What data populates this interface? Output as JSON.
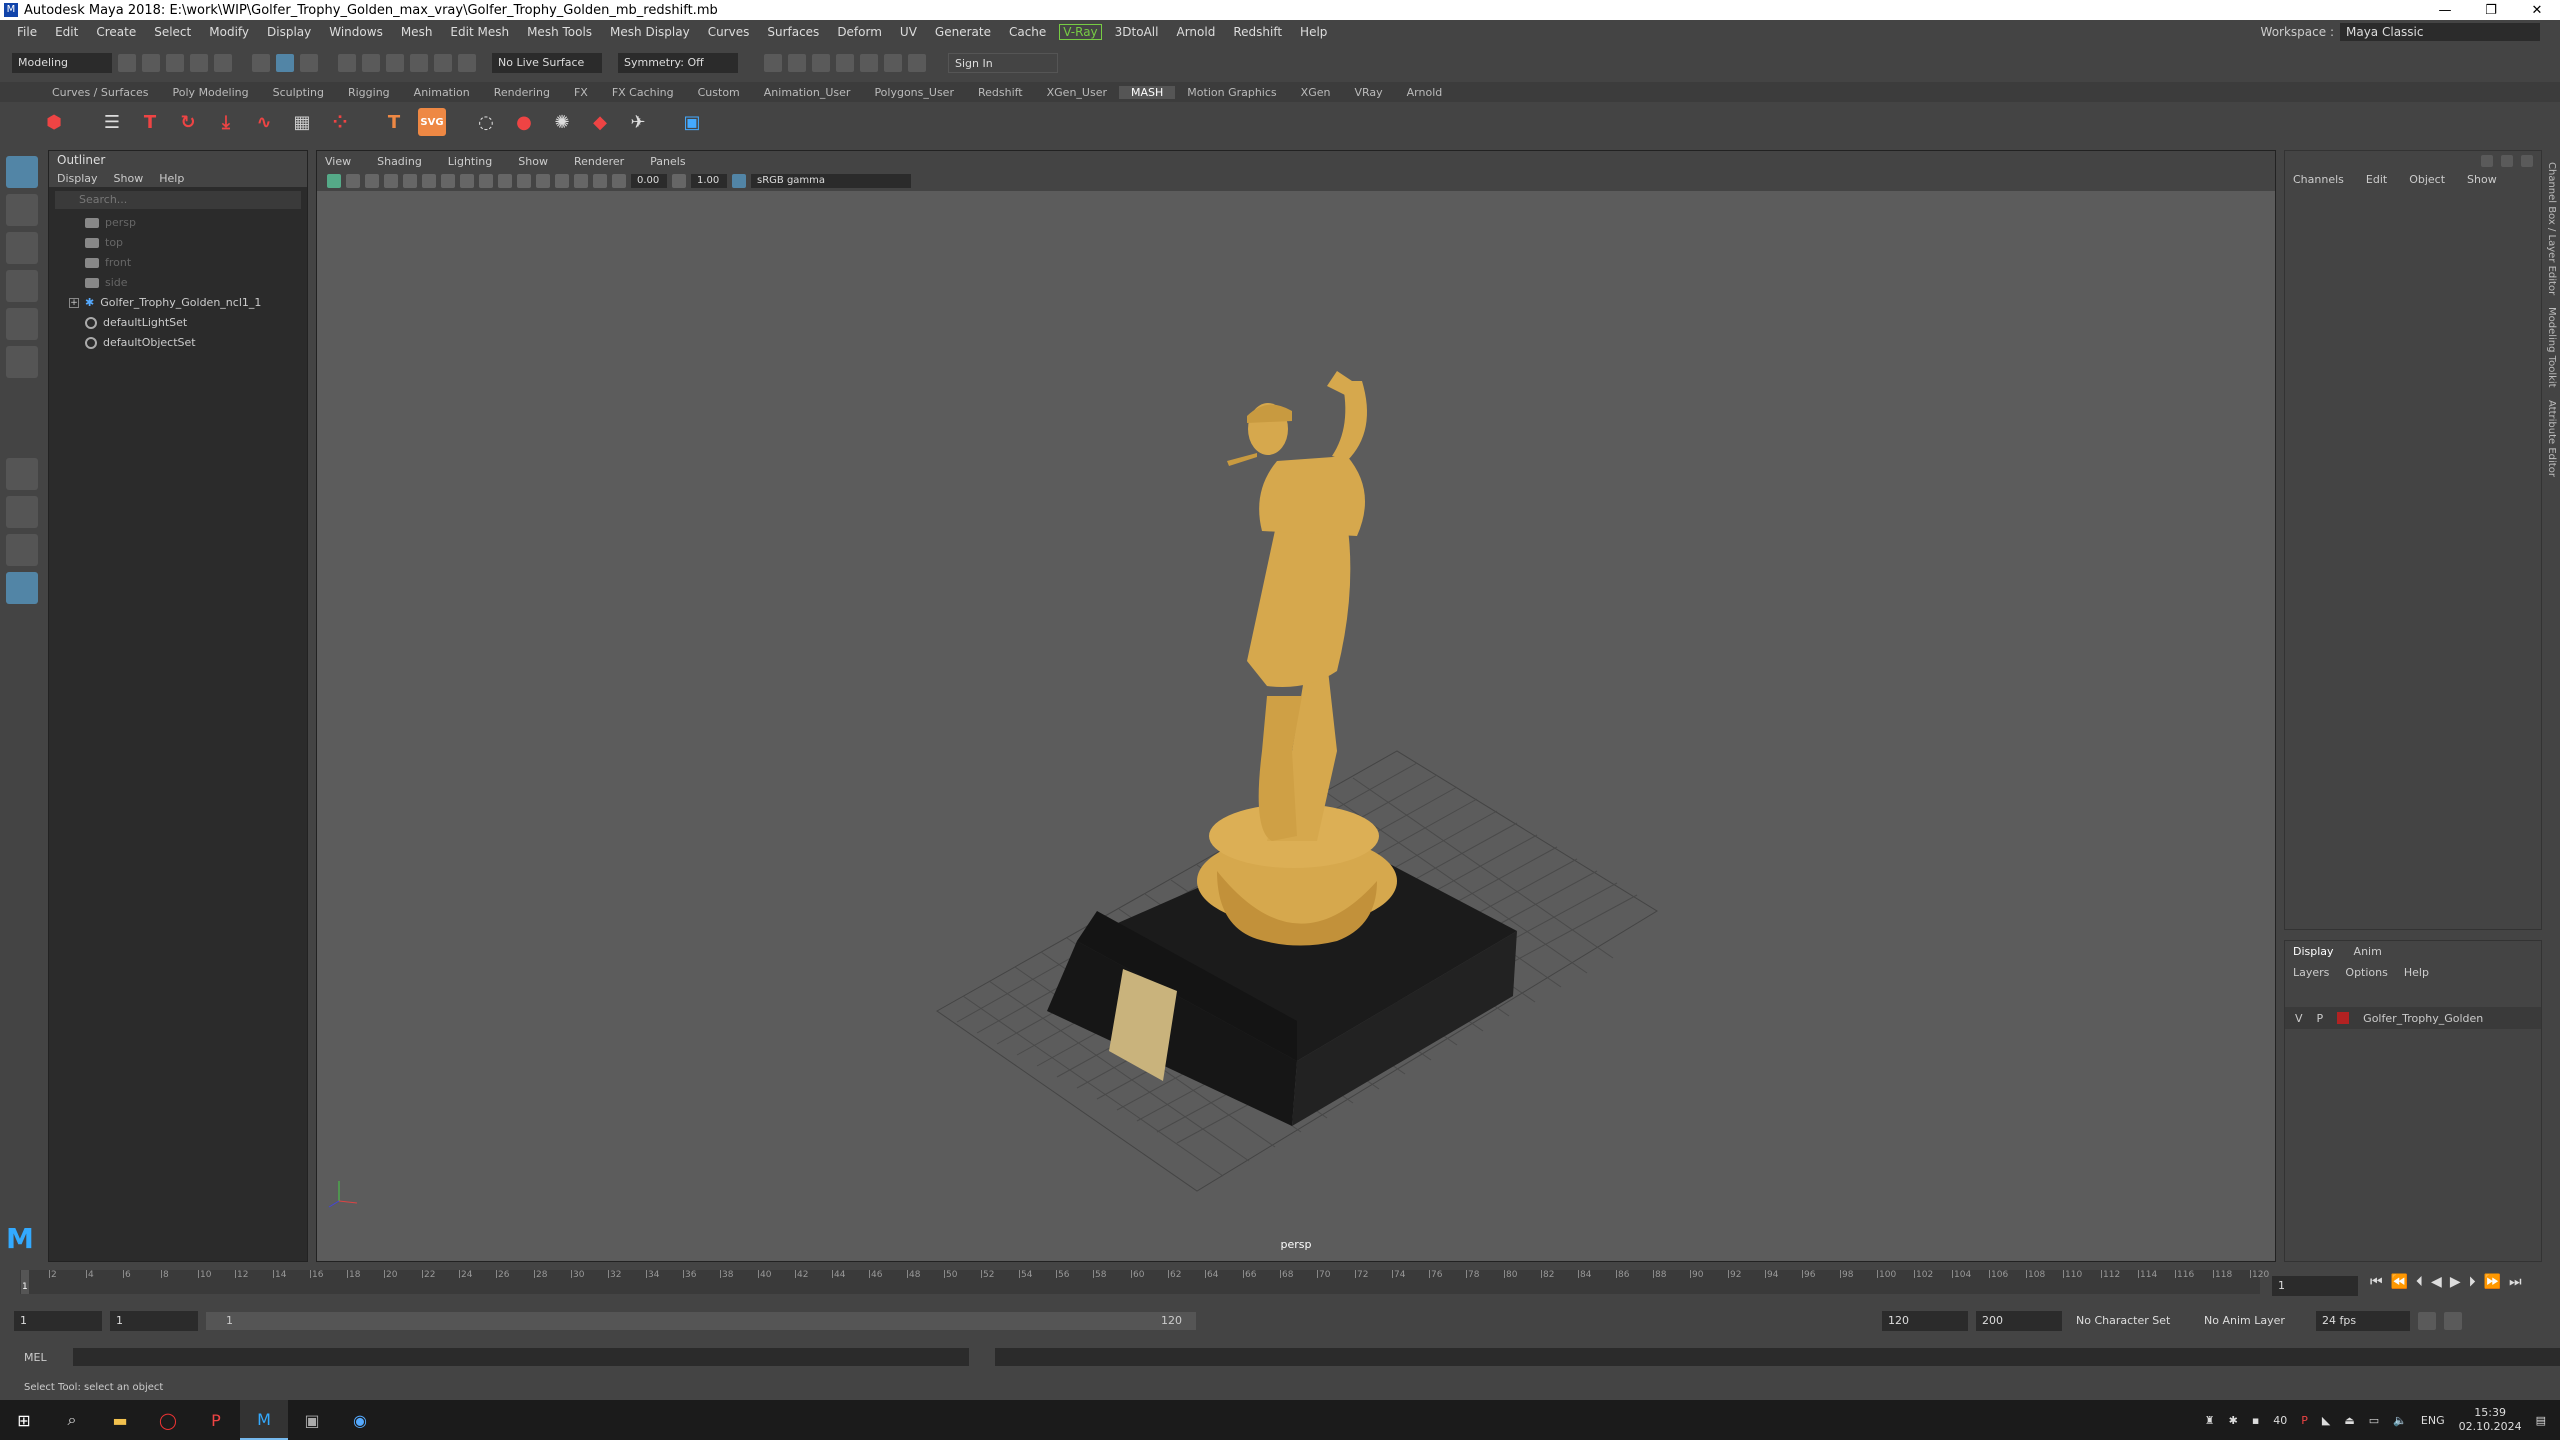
{
  "window": {
    "title": "Autodesk Maya 2018: E:\\work\\WIP\\Golfer_Trophy_Golden_max_vray\\Golfer_Trophy_Golden_mb_redshift.mb"
  },
  "menubar": {
    "items": [
      "File",
      "Edit",
      "Create",
      "Select",
      "Modify",
      "Display",
      "Windows",
      "Mesh",
      "Edit Mesh",
      "Mesh Tools",
      "Mesh Display",
      "Curves",
      "Surfaces",
      "Deform",
      "UV",
      "Generate",
      "Cache"
    ],
    "vray": "V-Ray",
    "items2": [
      "3DtoAll",
      "Arnold",
      "Redshift",
      "Help"
    ],
    "workspace_label": "Workspace :",
    "workspace_value": "Maya Classic"
  },
  "statusline": {
    "mode": "Modeling",
    "live_surface": "No Live Surface",
    "symmetry": "Symmetry: Off",
    "sign_in": "Sign In"
  },
  "shelf_tabs": [
    "Curves / Surfaces",
    "Poly Modeling",
    "Sculpting",
    "Rigging",
    "Animation",
    "Rendering",
    "FX",
    "FX Caching",
    "Custom",
    "Animation_User",
    "Polygons_User",
    "Redshift",
    "XGen_User",
    "MASH",
    "Motion Graphics",
    "XGen",
    "VRay",
    "Arnold"
  ],
  "shelf_active": "MASH",
  "outliner": {
    "title": "Outliner",
    "menu": [
      "Display",
      "Show",
      "Help"
    ],
    "search_placeholder": "Search...",
    "items": [
      {
        "label": "persp",
        "dim": true
      },
      {
        "label": "top",
        "dim": true
      },
      {
        "label": "front",
        "dim": true
      },
      {
        "label": "side",
        "dim": true
      },
      {
        "label": "Golfer_Trophy_Golden_ncl1_1",
        "dim": false
      },
      {
        "label": "defaultLightSet",
        "dim": false
      },
      {
        "label": "defaultObjectSet",
        "dim": false
      }
    ]
  },
  "viewport": {
    "menu": [
      "View",
      "Shading",
      "Lighting",
      "Show",
      "Renderer",
      "Panels"
    ],
    "exposure": "0.00",
    "gamma": "1.00",
    "colorspace": "sRGB gamma",
    "camera": "persp"
  },
  "channelbox": {
    "menu": [
      "Channels",
      "Edit",
      "Object",
      "Show"
    ]
  },
  "layer_editor": {
    "tabs": [
      "Display",
      "Anim"
    ],
    "menu": [
      "Layers",
      "Options",
      "Help"
    ],
    "layer": {
      "v": "V",
      "p": "P",
      "name": "Golfer_Trophy_Golden",
      "color": "#b22222"
    }
  },
  "side_tabs": [
    "Channel Box / Layer Editor",
    "Modeling Toolkit",
    "Attribute Editor"
  ],
  "timeline": {
    "ticks": [
      "2",
      "4",
      "6",
      "8",
      "10",
      "12",
      "14",
      "16",
      "18",
      "20",
      "22",
      "24",
      "26",
      "28",
      "30",
      "32",
      "34",
      "36",
      "38",
      "40",
      "42",
      "44",
      "46",
      "48",
      "50",
      "52",
      "54",
      "56",
      "58",
      "60",
      "62",
      "64",
      "66",
      "68",
      "70",
      "72",
      "74",
      "76",
      "78",
      "80",
      "82",
      "84",
      "86",
      "88",
      "90",
      "92",
      "94",
      "96",
      "98",
      "100",
      "102",
      "104",
      "106",
      "108",
      "110",
      "112",
      "114",
      "116",
      "118",
      "120"
    ],
    "current_frame": "1",
    "current_field": "1"
  },
  "range": {
    "start": "1",
    "playback_start": "1",
    "slider_start": "1",
    "slider_end": "120",
    "playback_end": "120",
    "end": "200",
    "character_set": "No Character Set",
    "anim_layer": "No Anim Layer",
    "fps": "24 fps"
  },
  "command": {
    "label": "MEL"
  },
  "help_line": "Select Tool: select an object",
  "taskbar": {
    "lang": "ENG",
    "time": "15:39",
    "date": "02.10.2024",
    "temp": "40"
  }
}
